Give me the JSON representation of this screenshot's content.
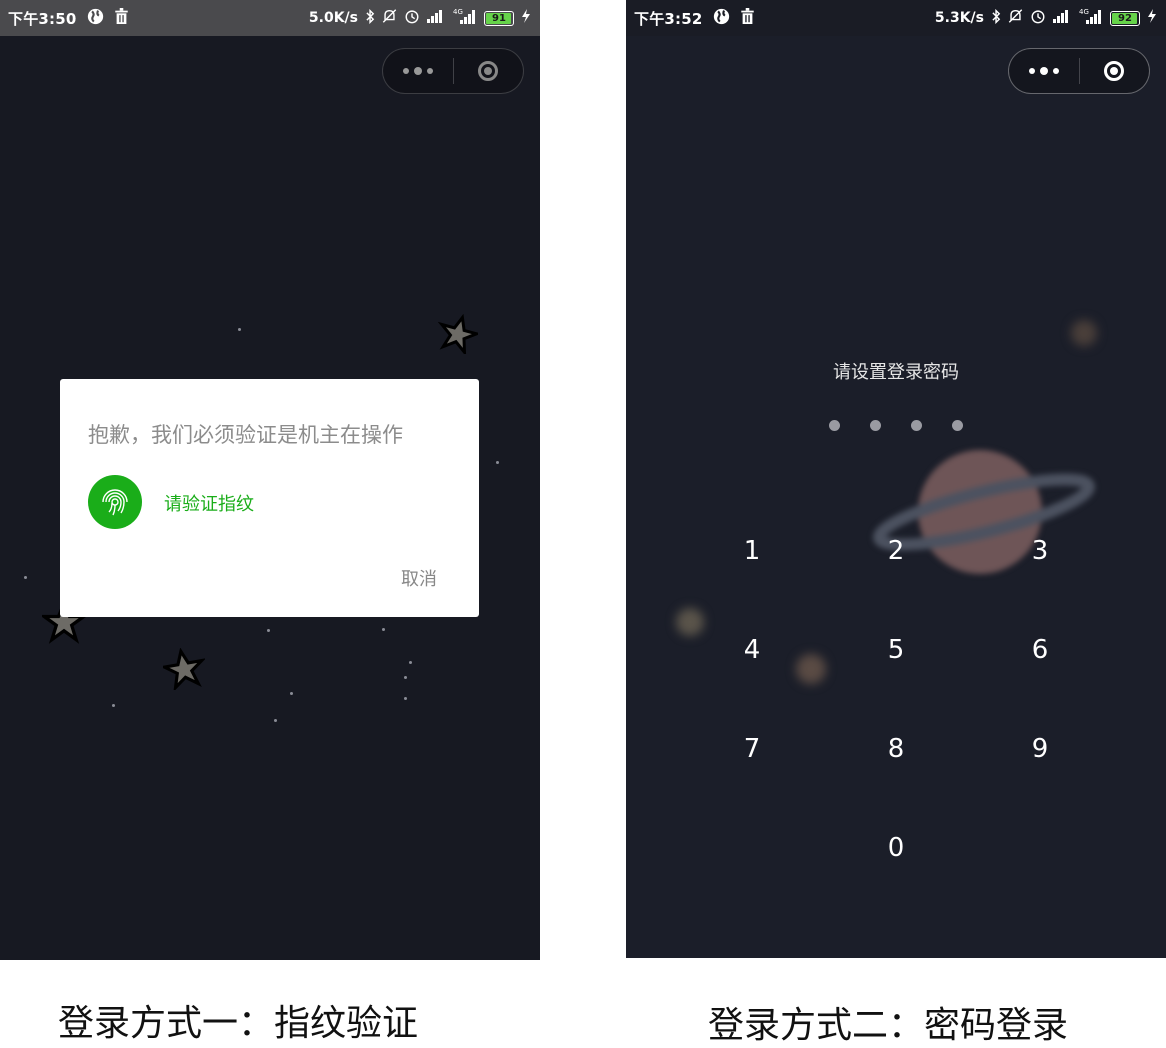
{
  "left_screen": {
    "status_bar": {
      "time": "下午3:50",
      "net_speed": "5.0K/s",
      "network": "4G",
      "battery": "91"
    },
    "dialog": {
      "title": "抱歉，我们必须验证是机主在操作",
      "fingerprint_prompt": "请验证指纹",
      "cancel": "取消"
    },
    "caption": "登录方式一：指纹验证"
  },
  "right_screen": {
    "status_bar": {
      "time": "下午3:52",
      "net_speed": "5.3K/s",
      "network": "4G",
      "battery": "92"
    },
    "title": "请设置登录密码",
    "keys": [
      "1",
      "2",
      "3",
      "4",
      "5",
      "6",
      "7",
      "8",
      "9",
      "0"
    ],
    "caption": "登录方式二：密码登录"
  },
  "colors": {
    "accent_green": "#1aad19",
    "background": "#171922"
  }
}
